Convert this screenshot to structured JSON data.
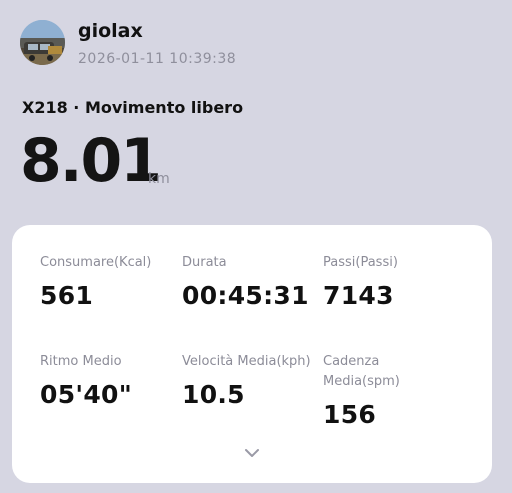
{
  "user": {
    "name": "giolax",
    "timestamp": "2026-01-11 10:39:38"
  },
  "activity": {
    "title": "X218 · Movimento libero",
    "distance_value": "8.01",
    "distance_unit": "km"
  },
  "stats": [
    {
      "label": "Consumare(Kcal)",
      "value": "561"
    },
    {
      "label": "Durata",
      "value": "00:45:31"
    },
    {
      "label": "Passi(Passi)",
      "value": "7143"
    },
    {
      "label": "Ritmo Medio",
      "value": "05'40\""
    },
    {
      "label": "Velocità Media(kph)",
      "value": "10.5"
    },
    {
      "label": "Cadenza Media(spm)",
      "value": "156"
    }
  ],
  "icons": {
    "expand": "chevron-down-icon",
    "avatar": "user-avatar"
  },
  "colors": {
    "background": "#d6d6e2",
    "card": "#ffffff",
    "muted_text": "#8f8f9c"
  }
}
